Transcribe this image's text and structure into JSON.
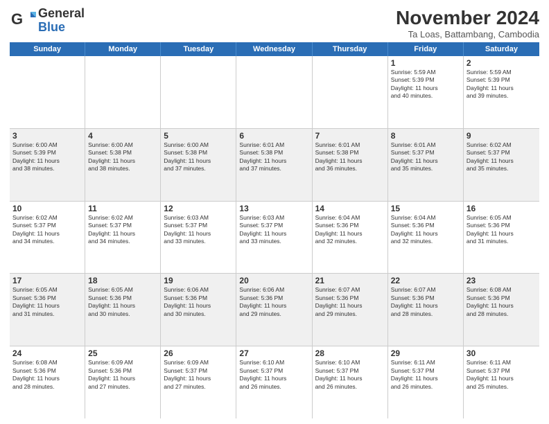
{
  "header": {
    "logo": {
      "general": "General",
      "blue": "Blue"
    },
    "title": "November 2024",
    "subtitle": "Ta Loas, Battambang, Cambodia"
  },
  "days_of_week": [
    "Sunday",
    "Monday",
    "Tuesday",
    "Wednesday",
    "Thursday",
    "Friday",
    "Saturday"
  ],
  "weeks": [
    [
      {
        "day": "",
        "info": ""
      },
      {
        "day": "",
        "info": ""
      },
      {
        "day": "",
        "info": ""
      },
      {
        "day": "",
        "info": ""
      },
      {
        "day": "",
        "info": ""
      },
      {
        "day": "1",
        "info": "Sunrise: 5:59 AM\nSunset: 5:39 PM\nDaylight: 11 hours\nand 40 minutes."
      },
      {
        "day": "2",
        "info": "Sunrise: 5:59 AM\nSunset: 5:39 PM\nDaylight: 11 hours\nand 39 minutes."
      }
    ],
    [
      {
        "day": "3",
        "info": "Sunrise: 6:00 AM\nSunset: 5:39 PM\nDaylight: 11 hours\nand 38 minutes."
      },
      {
        "day": "4",
        "info": "Sunrise: 6:00 AM\nSunset: 5:38 PM\nDaylight: 11 hours\nand 38 minutes."
      },
      {
        "day": "5",
        "info": "Sunrise: 6:00 AM\nSunset: 5:38 PM\nDaylight: 11 hours\nand 37 minutes."
      },
      {
        "day": "6",
        "info": "Sunrise: 6:01 AM\nSunset: 5:38 PM\nDaylight: 11 hours\nand 37 minutes."
      },
      {
        "day": "7",
        "info": "Sunrise: 6:01 AM\nSunset: 5:38 PM\nDaylight: 11 hours\nand 36 minutes."
      },
      {
        "day": "8",
        "info": "Sunrise: 6:01 AM\nSunset: 5:37 PM\nDaylight: 11 hours\nand 35 minutes."
      },
      {
        "day": "9",
        "info": "Sunrise: 6:02 AM\nSunset: 5:37 PM\nDaylight: 11 hours\nand 35 minutes."
      }
    ],
    [
      {
        "day": "10",
        "info": "Sunrise: 6:02 AM\nSunset: 5:37 PM\nDaylight: 11 hours\nand 34 minutes."
      },
      {
        "day": "11",
        "info": "Sunrise: 6:02 AM\nSunset: 5:37 PM\nDaylight: 11 hours\nand 34 minutes."
      },
      {
        "day": "12",
        "info": "Sunrise: 6:03 AM\nSunset: 5:37 PM\nDaylight: 11 hours\nand 33 minutes."
      },
      {
        "day": "13",
        "info": "Sunrise: 6:03 AM\nSunset: 5:37 PM\nDaylight: 11 hours\nand 33 minutes."
      },
      {
        "day": "14",
        "info": "Sunrise: 6:04 AM\nSunset: 5:36 PM\nDaylight: 11 hours\nand 32 minutes."
      },
      {
        "day": "15",
        "info": "Sunrise: 6:04 AM\nSunset: 5:36 PM\nDaylight: 11 hours\nand 32 minutes."
      },
      {
        "day": "16",
        "info": "Sunrise: 6:05 AM\nSunset: 5:36 PM\nDaylight: 11 hours\nand 31 minutes."
      }
    ],
    [
      {
        "day": "17",
        "info": "Sunrise: 6:05 AM\nSunset: 5:36 PM\nDaylight: 11 hours\nand 31 minutes."
      },
      {
        "day": "18",
        "info": "Sunrise: 6:05 AM\nSunset: 5:36 PM\nDaylight: 11 hours\nand 30 minutes."
      },
      {
        "day": "19",
        "info": "Sunrise: 6:06 AM\nSunset: 5:36 PM\nDaylight: 11 hours\nand 30 minutes."
      },
      {
        "day": "20",
        "info": "Sunrise: 6:06 AM\nSunset: 5:36 PM\nDaylight: 11 hours\nand 29 minutes."
      },
      {
        "day": "21",
        "info": "Sunrise: 6:07 AM\nSunset: 5:36 PM\nDaylight: 11 hours\nand 29 minutes."
      },
      {
        "day": "22",
        "info": "Sunrise: 6:07 AM\nSunset: 5:36 PM\nDaylight: 11 hours\nand 28 minutes."
      },
      {
        "day": "23",
        "info": "Sunrise: 6:08 AM\nSunset: 5:36 PM\nDaylight: 11 hours\nand 28 minutes."
      }
    ],
    [
      {
        "day": "24",
        "info": "Sunrise: 6:08 AM\nSunset: 5:36 PM\nDaylight: 11 hours\nand 28 minutes."
      },
      {
        "day": "25",
        "info": "Sunrise: 6:09 AM\nSunset: 5:36 PM\nDaylight: 11 hours\nand 27 minutes."
      },
      {
        "day": "26",
        "info": "Sunrise: 6:09 AM\nSunset: 5:37 PM\nDaylight: 11 hours\nand 27 minutes."
      },
      {
        "day": "27",
        "info": "Sunrise: 6:10 AM\nSunset: 5:37 PM\nDaylight: 11 hours\nand 26 minutes."
      },
      {
        "day": "28",
        "info": "Sunrise: 6:10 AM\nSunset: 5:37 PM\nDaylight: 11 hours\nand 26 minutes."
      },
      {
        "day": "29",
        "info": "Sunrise: 6:11 AM\nSunset: 5:37 PM\nDaylight: 11 hours\nand 26 minutes."
      },
      {
        "day": "30",
        "info": "Sunrise: 6:11 AM\nSunset: 5:37 PM\nDaylight: 11 hours\nand 25 minutes."
      }
    ]
  ]
}
